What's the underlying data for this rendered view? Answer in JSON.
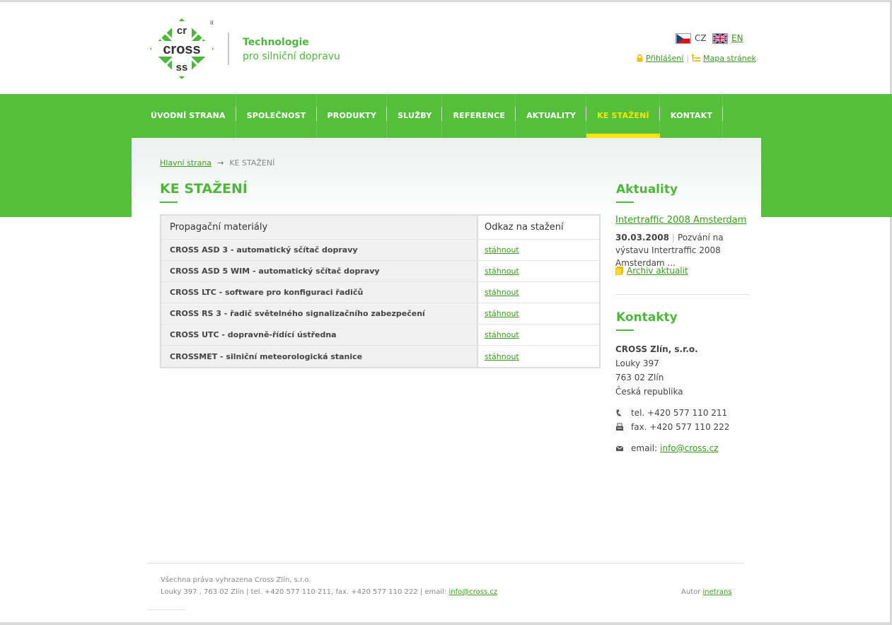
{
  "header": {
    "tagline_1": "Technologie",
    "tagline_2": "pro silniční dopravu",
    "logo_text": "cross",
    "lang_cz": "CZ",
    "lang_en": "EN",
    "login": "Přihlášení",
    "sitemap": "Mapa stránek",
    "separator": "|"
  },
  "nav": {
    "items": [
      "ÚVODNÍ STRANA",
      "SPOLEČNOST",
      "PRODUKTY",
      "SLUŽBY",
      "REFERENCE",
      "AKTUALITY",
      "KE STAŽENÍ",
      "KONTAKT"
    ],
    "active": "KE STAŽENÍ"
  },
  "breadcrumb": {
    "home": "Hlavní strana",
    "arrow": "→",
    "current": "KE STAŽENÍ"
  },
  "main": {
    "title": "KE STAŽENÍ",
    "table": {
      "headers": [
        "Propagační materiály",
        "Odkaz na stažení"
      ],
      "rows": [
        {
          "name": "CROSS ASD 3 - automatický sčítač dopravy",
          "link": "stáhnout"
        },
        {
          "name": "CROSS ASD 5 WIM - automatický sčítač dopravy",
          "link": "stáhnout"
        },
        {
          "name": "CROSS LTC - software pro konfiguraci řadičů",
          "link": "stáhnout"
        },
        {
          "name": "CROSS RS 3 - řadič světelného signalizačního zabezpečení",
          "link": "stáhnout"
        },
        {
          "name": "CROSS UTC - dopravně-řídící ústředna",
          "link": "stáhnout"
        },
        {
          "name": "CROSSMET - silniční meteorologická stanice",
          "link": "stáhnout"
        }
      ]
    }
  },
  "sidebar": {
    "news_title": "Aktuality",
    "news_link": "Intertraffic 2008 Amsterdam",
    "news_date": "30.03.2008",
    "news_sep": "|",
    "news_text": "Pozvání na výstavu Intertraffic 2008 Amsterdam ...",
    "archive": "Archiv aktualit",
    "contacts_title": "Kontakty",
    "company": "CROSS Zlín, s.r.o.",
    "street": "Louky 397",
    "city": "763 02 Zlín",
    "country": "Česká republika",
    "tel": "tel. +420 577 110 211",
    "fax": "fax. +420 577 110 222",
    "email_label": "email:",
    "email": "info@cross.cz"
  },
  "footer": {
    "rights": "Všechna práva vyhrazena Cross Zlín, s.r.o.",
    "address": "Louky 397 , 763 02 Zlín | tel. +420 577 110 211, fax. +420 577 110 222 | email:",
    "email": "info@cross.cz",
    "author_label": "Autor",
    "author": "inetrans"
  },
  "colors": {
    "brand_green": "#55bf3c",
    "text_green": "#3a9a1e",
    "active_yellow": "#ffe400"
  },
  "icons": [
    "cross-logo",
    "cz-flag-icon",
    "uk-flag-icon",
    "lock-icon",
    "sitemap-icon",
    "archive-icon",
    "phone-icon",
    "fax-icon",
    "mail-icon",
    "arrow-right-icon"
  ]
}
